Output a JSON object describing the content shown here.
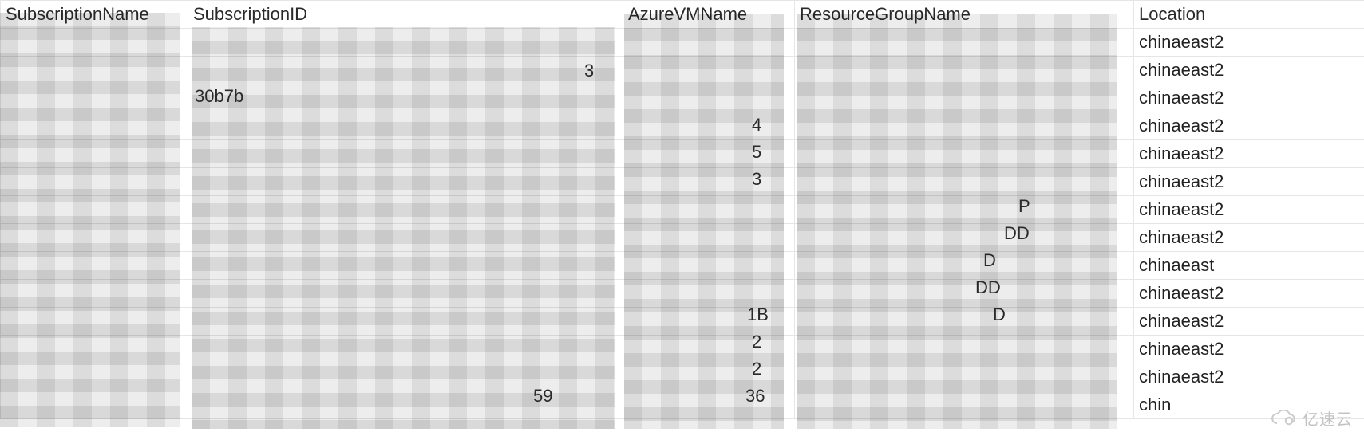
{
  "table": {
    "headers": {
      "subscriptionName": "SubscriptionName",
      "subscriptionID": "SubscriptionID",
      "azureVMName": "AzureVMName",
      "resourceGroupName": "ResourceGroupName",
      "location": "Location"
    },
    "rows": [
      {
        "subscriptionName": "",
        "subscriptionID": "",
        "azureVMName": "",
        "resourceGroupName": "",
        "location": "chinaeast2"
      },
      {
        "subscriptionName": "",
        "subscriptionID": "",
        "azureVMName": "",
        "resourceGroupName": "",
        "location": "chinaeast2"
      },
      {
        "subscriptionName": "",
        "subscriptionID": "",
        "azureVMName": "",
        "resourceGroupName": "",
        "location": "chinaeast2"
      },
      {
        "subscriptionName": "",
        "subscriptionID": "",
        "azureVMName": "",
        "resourceGroupName": "",
        "location": "chinaeast2"
      },
      {
        "subscriptionName": "",
        "subscriptionID": "",
        "azureVMName": "",
        "resourceGroupName": "",
        "location": "chinaeast2"
      },
      {
        "subscriptionName": "",
        "subscriptionID": "",
        "azureVMName": "",
        "resourceGroupName": "",
        "location": "chinaeast2"
      },
      {
        "subscriptionName": "",
        "subscriptionID": "",
        "azureVMName": "",
        "resourceGroupName": "",
        "location": "chinaeast2"
      },
      {
        "subscriptionName": "",
        "subscriptionID": "",
        "azureVMName": "",
        "resourceGroupName": "",
        "location": "chinaeast2"
      },
      {
        "subscriptionName": "",
        "subscriptionID": "",
        "azureVMName": "",
        "resourceGroupName": "",
        "location": "chinaeast"
      },
      {
        "subscriptionName": "",
        "subscriptionID": "",
        "azureVMName": "",
        "resourceGroupName": "",
        "location": "chinaeast2"
      },
      {
        "subscriptionName": "",
        "subscriptionID": "",
        "azureVMName": "",
        "resourceGroupName": "",
        "location": "chinaeast2"
      },
      {
        "subscriptionName": "",
        "subscriptionID": "",
        "azureVMName": "",
        "resourceGroupName": "",
        "location": "chinaeast2"
      },
      {
        "subscriptionName": "",
        "subscriptionID": "",
        "azureVMName": "",
        "resourceGroupName": "",
        "location": "chinaeast2"
      },
      {
        "subscriptionName": "",
        "subscriptionID": "",
        "azureVMName": "",
        "resourceGroupName": "",
        "location": "chin"
      }
    ],
    "redacted_peeks": {
      "subid_row2_suffix": "3",
      "subid_row3_prefix": "30b7b",
      "vm_row4": "4",
      "vm_row5": "5",
      "vm_row6": "3",
      "rg_row7": "P",
      "rg_row8": "DD",
      "rg_row9": "D",
      "rg_row10": "DD",
      "vm_row11": "1B",
      "rg_row11": "D",
      "vm_row12": "2",
      "vm_row13": "2",
      "subid_row14": "59",
      "vm_row14": "36"
    }
  },
  "watermark": {
    "text": "亿速云"
  }
}
